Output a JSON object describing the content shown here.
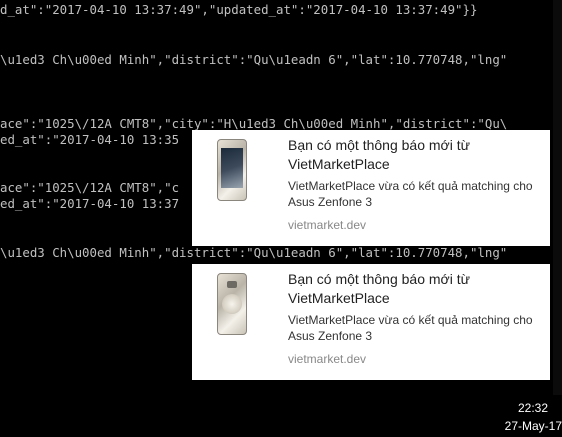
{
  "console": {
    "lines": [
      "d_at\":\"2017-04-10 13:37:49\",\"updated_at\":\"2017-04-10 13:37:49\"}}",
      "\\u1ed3 Ch\\u00ed Minh\",\"district\":\"Qu\\u1eadn 6\",\"lat\":10.770748,\"lng\"",
      "ace\":\"1025\\/12A CMT8\",\"city\":\"H\\u1ed3 Ch\\u00ed Minh\",\"district\":\"Qu\\",
      "ed_at\":\"2017-04-10 13:35",
      "ace\":\"1025\\/12A CMT8\",\"c",
      "ed_at\":\"2017-04-10 13:37",
      "\\u1ed3 Ch\\u00ed Minh\",\"district\":\"Qu\\u1eadn 6\",\"lat\":10.770748,\"lng\""
    ]
  },
  "notifications": [
    {
      "title": "Bạn có một thông báo mới từ VietMarketPlace",
      "body": "VietMarketPlace vừa có kết quả matching cho Asus Zenfone 3",
      "source": "vietmarket.dev",
      "image_icon": "phone-front-image"
    },
    {
      "title": "Bạn có một thông báo mới từ VietMarketPlace",
      "body": "VietMarketPlace vừa có kết quả matching cho Asus Zenfone 3",
      "source": "vietmarket.dev",
      "image_icon": "phone-back-image"
    }
  ],
  "clock": {
    "time": "22:32",
    "date": "27-May-17"
  }
}
